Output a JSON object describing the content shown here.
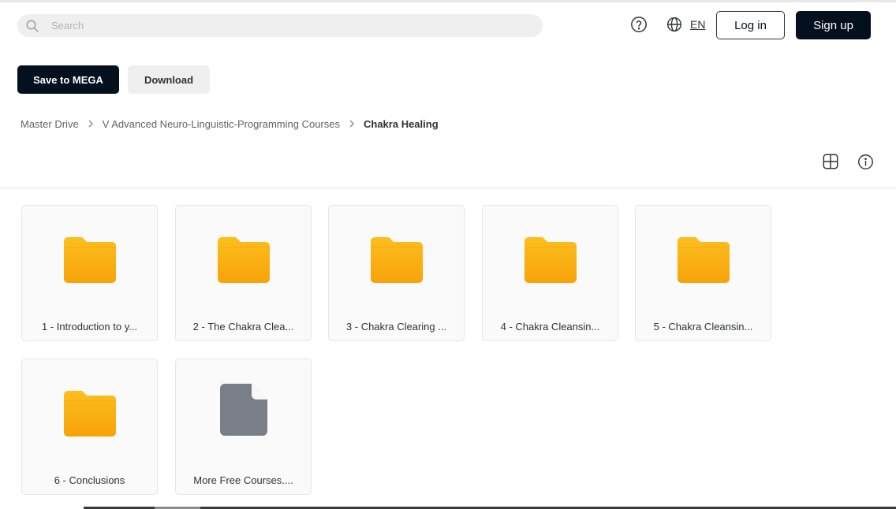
{
  "header": {
    "search_placeholder": "Search",
    "language": "EN",
    "login_label": "Log in",
    "signup_label": "Sign up"
  },
  "actions": {
    "save_label": "Save to MEGA",
    "download_label": "Download"
  },
  "breadcrumb": [
    "Master Drive",
    "V Advanced Neuro-Linguistic-Programming Courses",
    "Chakra Healing"
  ],
  "items": [
    {
      "type": "folder",
      "name": "1 - Introduction to y..."
    },
    {
      "type": "folder",
      "name": "2 - The Chakra Clea..."
    },
    {
      "type": "folder",
      "name": "3 - Chakra Clearing ..."
    },
    {
      "type": "folder",
      "name": "4 - Chakra Cleansin..."
    },
    {
      "type": "folder",
      "name": "5 - Chakra Cleansin..."
    },
    {
      "type": "folder",
      "name": "6 - Conclusions"
    },
    {
      "type": "file",
      "name": "More Free Courses...."
    }
  ],
  "icons": {
    "search": "search-icon",
    "help": "help-icon",
    "language": "globe-icon",
    "view": "grid-view-icon",
    "info": "info-icon",
    "folder": "folder-icon",
    "file": "file-icon"
  },
  "colors": {
    "primary": "#04101e",
    "folder_top": "#fdbe1e",
    "folder_bottom": "#f7a308",
    "file": "#7a7f87"
  }
}
